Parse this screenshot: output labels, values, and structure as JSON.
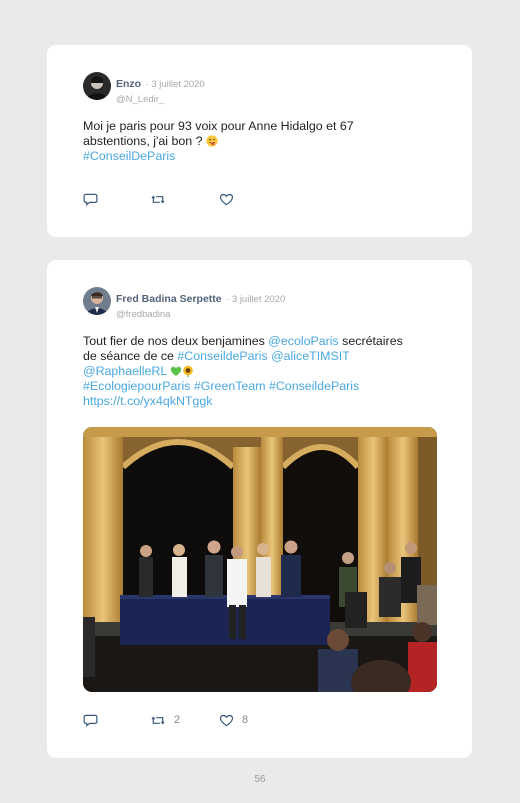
{
  "tweets": [
    {
      "name": "Enzo",
      "date": "3 juillet 2020",
      "handle": "@N_Ledir_",
      "text_lines": [
        "Moi je paris pour 93 voix pour Anne Hidalgo et 67",
        "abstentions, j'ai bon ?"
      ],
      "emoji": "winking-tongue-face",
      "hashtag": "#ConseilDeParis",
      "retweets": "",
      "likes": ""
    },
    {
      "name": "Fred Badina Serpette",
      "date": "3 juillet 2020",
      "handle": "@fredbadina",
      "line1_text": "Tout fier de nos deux benjamines ",
      "line1_mention": "@ecoloParis",
      "line1_tail": " secrétaires",
      "line2_text": "de séance de ce ",
      "line2_tag": "#ConseildeParis",
      "line2_mention": "@aliceTIMSIT",
      "line3_mention": "@RaphaelleRL",
      "emojis": [
        "green-heart",
        "sunflower"
      ],
      "line4": "#EcologiepourParis #GreenTeam #ConseildeParis",
      "url": "https://t.co/yx4qkNTggk",
      "retweets": "2",
      "likes": "8"
    }
  ],
  "colors": {
    "link": "#4aa8e2",
    "name": "#54627a",
    "muted": "#a8a8a8",
    "background": "#ebeae8"
  },
  "page_number": "56"
}
